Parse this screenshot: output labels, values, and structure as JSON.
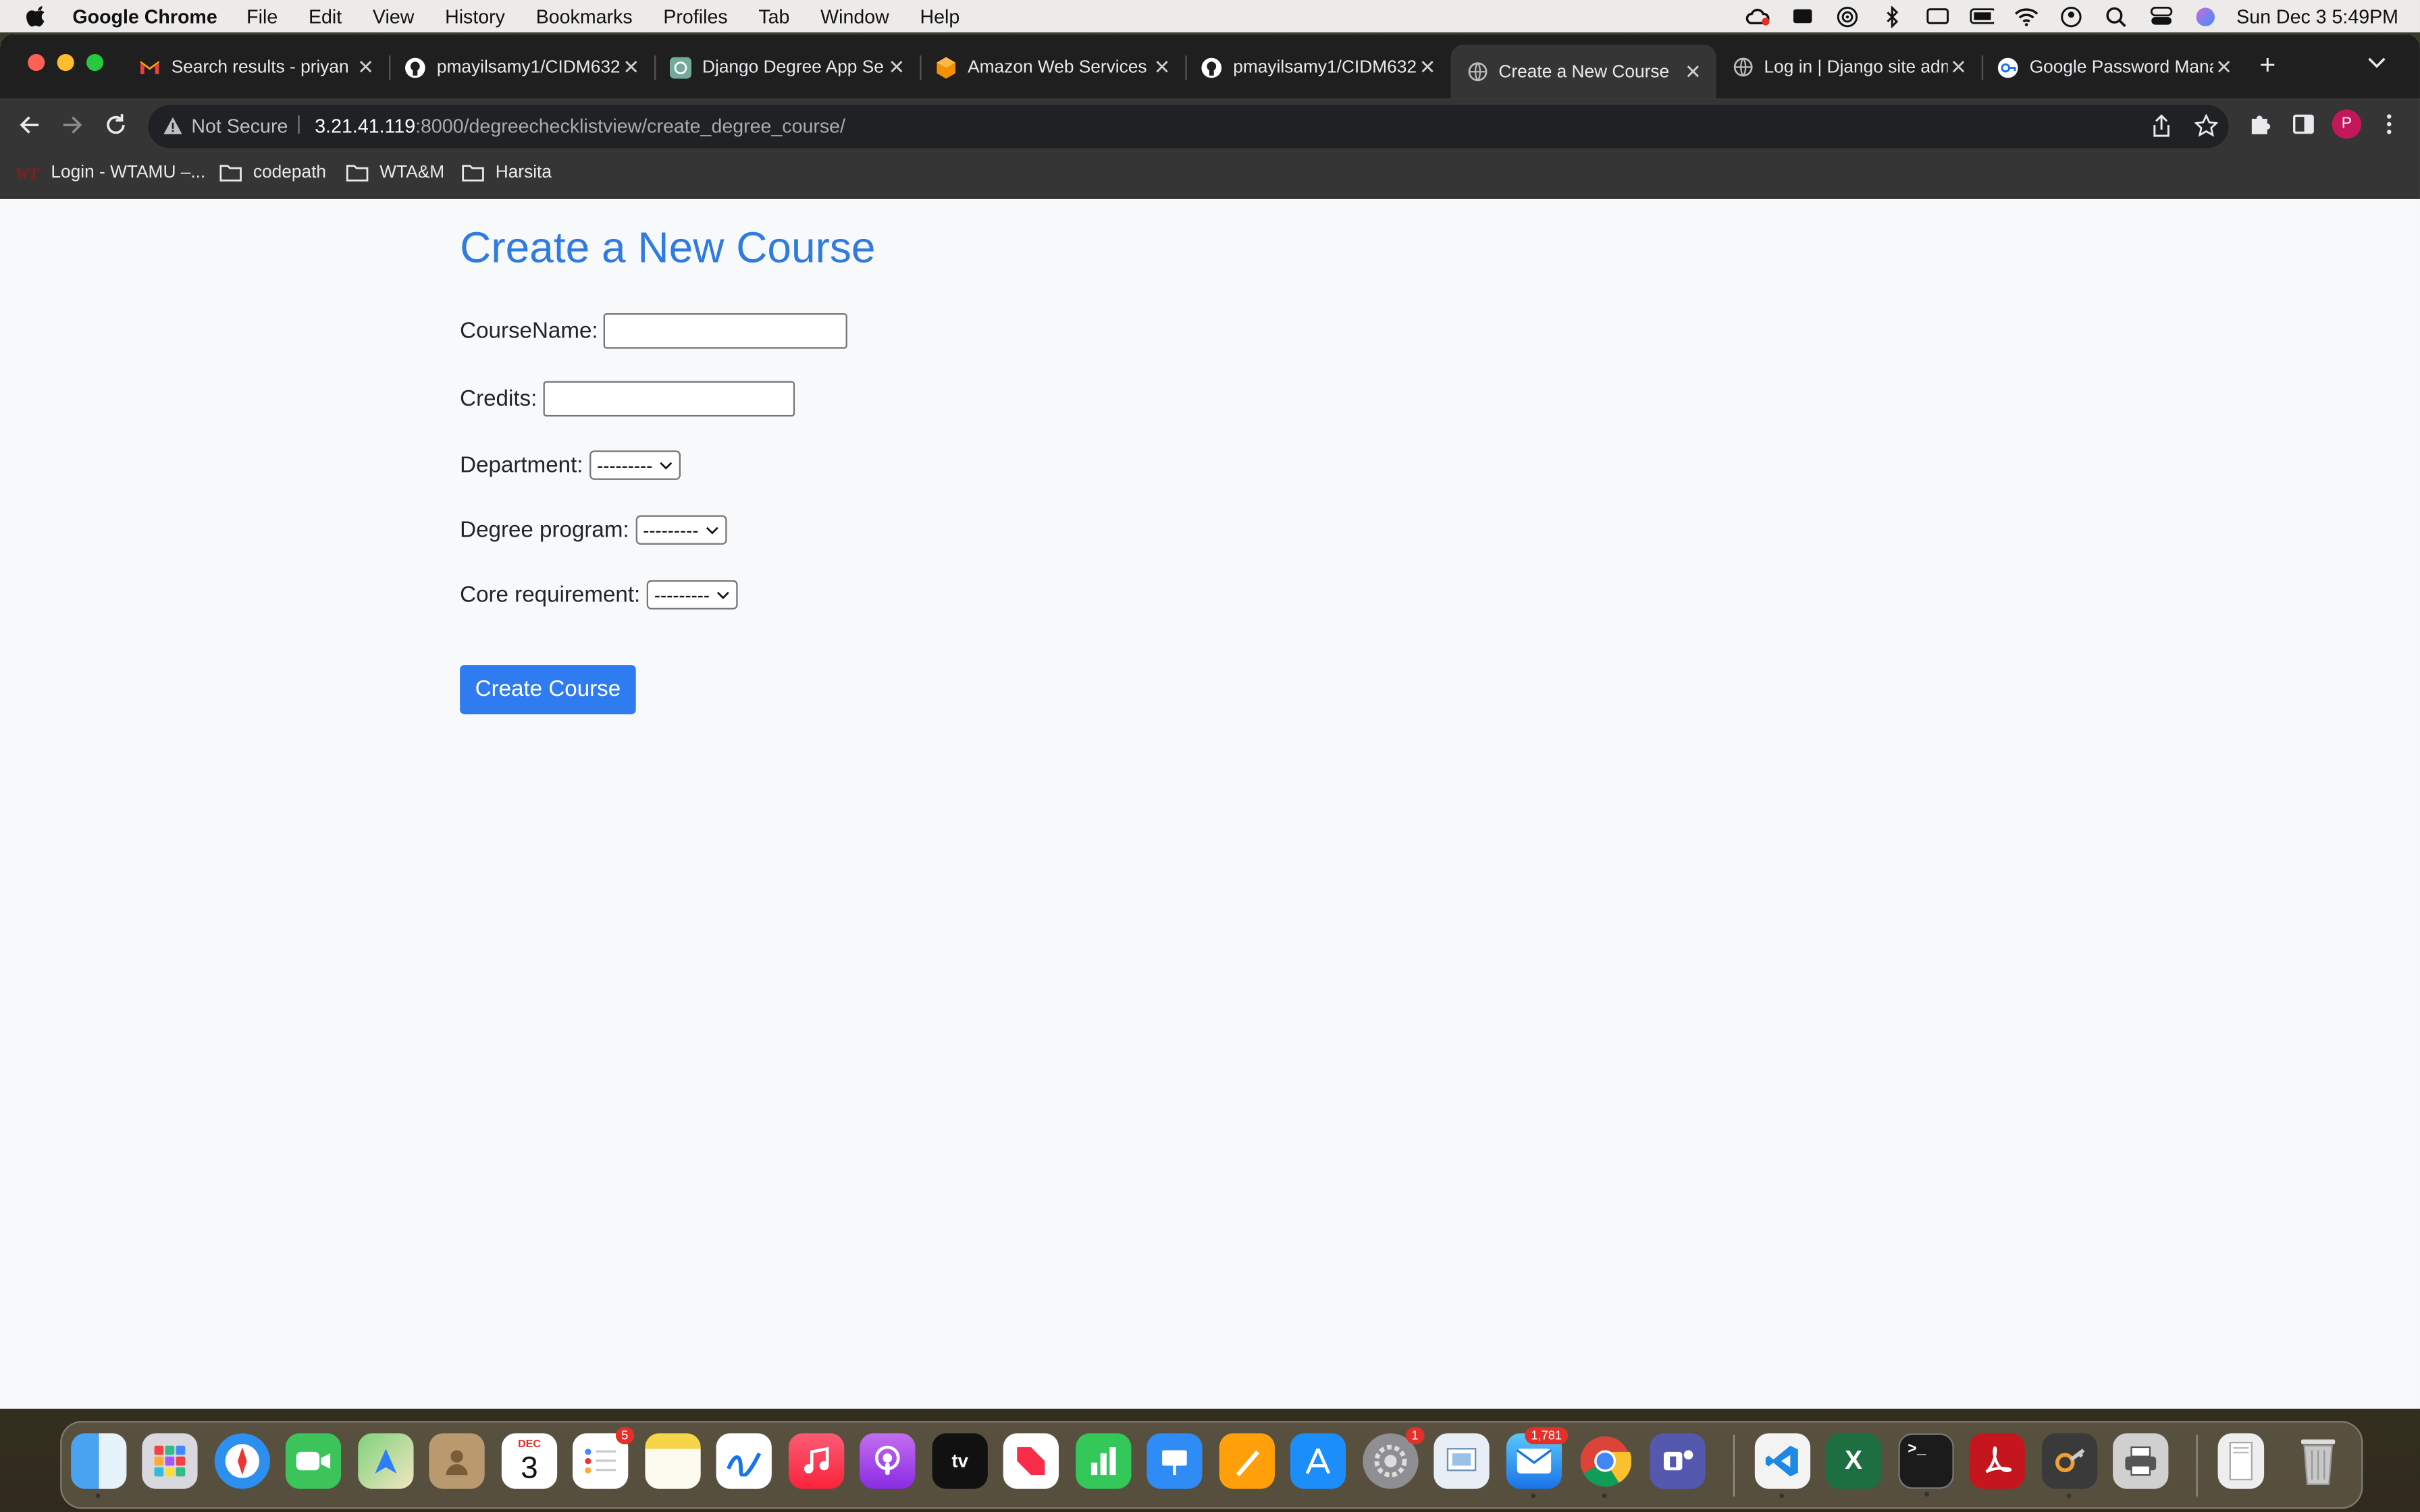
{
  "menubar": {
    "app_name": "Google Chrome",
    "menus": [
      "File",
      "Edit",
      "View",
      "History",
      "Bookmarks",
      "Profiles",
      "Tab",
      "Window",
      "Help"
    ],
    "clock": "Sun Dec 3  5:49PM"
  },
  "tabs": [
    {
      "label": "Search results - priyan",
      "icon": "gmail-icon"
    },
    {
      "label": "pmayilsamy1/CIDM632",
      "icon": "github-icon"
    },
    {
      "label": "Django Degree App Se",
      "icon": "chatgpt-icon"
    },
    {
      "label": "Amazon Web Services",
      "icon": "aws-icon"
    },
    {
      "label": "pmayilsamy1/CIDM632",
      "icon": "github-icon"
    },
    {
      "label": "Create a New Course",
      "icon": "globe-icon",
      "active": true
    },
    {
      "label": "Log in | Django site adm",
      "icon": "globe-icon"
    },
    {
      "label": "Google Password Mana",
      "icon": "password-manager-icon"
    }
  ],
  "address_bar": {
    "security_label": "Not Secure",
    "url_host": "3.21.41.119",
    "url_rest": ":8000/degreechecklistview/create_degree_course/"
  },
  "profile_initial": "P",
  "bookmarks": [
    {
      "label": "Login - WTAMU –...",
      "icon": "wt-logo-icon"
    },
    {
      "label": "codepath",
      "icon": "folder-icon"
    },
    {
      "label": "WTA&M",
      "icon": "folder-icon"
    },
    {
      "label": "Harsita",
      "icon": "folder-icon"
    }
  ],
  "form": {
    "title": "Create a New Course",
    "course_name_label": "CourseName:",
    "course_name_value": "",
    "credits_label": "Credits:",
    "credits_value": "",
    "department_label": "Department:",
    "department_selected": "---------",
    "degree_program_label": "Degree program:",
    "degree_program_selected": "---------",
    "core_requirement_label": "Core requirement:",
    "core_requirement_selected": "---------",
    "submit_label": "Create Course"
  },
  "dock": {
    "calendar_month": "DEC",
    "calendar_day": "3",
    "reminders_badge": "5",
    "settings_badge": "1",
    "mail_badge": "1,781",
    "tv_label": "tv",
    "items": [
      "finder-icon",
      "launchpad-icon",
      "safari-icon",
      "facetime-icon",
      "maps-icon",
      "contacts-icon",
      "calendar-icon",
      "reminders-icon",
      "notes-icon",
      "freeform-icon",
      "music-icon",
      "podcasts-icon",
      "apple-tv-icon",
      "news-icon",
      "numbers-icon",
      "keynote-icon",
      "pages-icon",
      "app-store-icon",
      "system-settings-icon",
      "preview-icon",
      "mail-icon",
      "chrome-icon",
      "teams-icon",
      "vscode-icon",
      "excel-icon",
      "terminal-icon",
      "acrobat-icon",
      "keychain-icon",
      "printer-icon",
      "downloads-stack-icon",
      "trash-icon"
    ]
  },
  "colors": {
    "title_blue": "#2f7bdf",
    "button_blue": "#2f7bf0",
    "page_bg": "#f8f9fa",
    "chrome_dark": "#353535"
  }
}
